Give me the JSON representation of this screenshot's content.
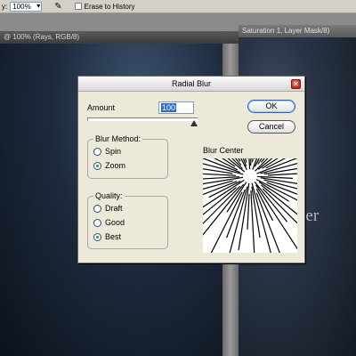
{
  "options_bar": {
    "opacity_label": "y:",
    "opacity_value": "100%",
    "erase_to_history_label": "Erase to History"
  },
  "documents": {
    "left_title": "@ 100% (Rays, RGB/8)",
    "right_title": "Saturation 1, Layer Mask/8)",
    "right_canvas_text": "water"
  },
  "dialog": {
    "title": "Radial Blur",
    "amount_label": "Amount",
    "amount_value": "100",
    "amount_fraction": 1.0,
    "ok_label": "OK",
    "cancel_label": "Cancel",
    "blur_method": {
      "legend": "Blur Method:",
      "options": [
        "Spin",
        "Zoom"
      ],
      "selected": "Zoom"
    },
    "quality": {
      "legend": "Quality:",
      "options": [
        "Draft",
        "Good",
        "Best"
      ],
      "selected": "Best"
    },
    "blur_center_label": "Blur Center"
  },
  "icons": {
    "close": "close-icon",
    "brush": "airbrush-icon"
  }
}
